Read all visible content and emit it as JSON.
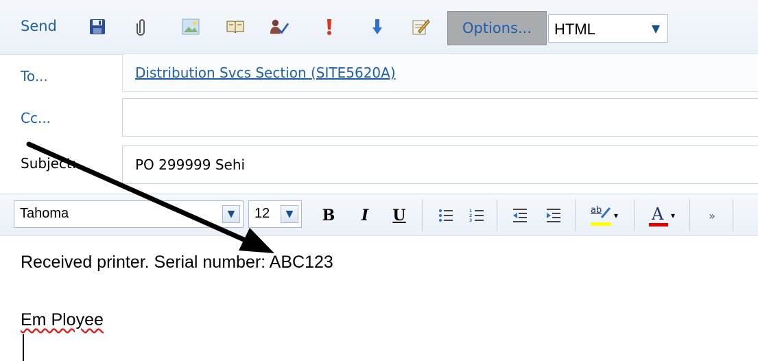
{
  "toolbar": {
    "send_label": "Send",
    "icons": [
      "save-icon",
      "attach-icon",
      "insert-picture-icon",
      "address-book-icon",
      "check-names-icon",
      "high-importance-icon",
      "low-importance-icon",
      "signature-icon"
    ],
    "options_label": "Options...",
    "format_value": "HTML"
  },
  "to": {
    "label": "To...",
    "value": "Distribution Svcs Section (SITE5620A)"
  },
  "cc": {
    "label": "Cc...",
    "value": ""
  },
  "subject": {
    "label": "Subject:",
    "value": "PO 299999 Sehi"
  },
  "formatting": {
    "font": "Tahoma",
    "size": "12",
    "bold": "B",
    "italic": "I",
    "underline": "U",
    "font_color_letter": "A",
    "highlight_letters": "ab"
  },
  "body": {
    "line1": "Received printer. Serial number: ABC123",
    "signature": "Em Ployee"
  },
  "colors": {
    "accent": "#1f5fa8",
    "highlight": "#ffff00",
    "font_color": "#e00000"
  }
}
